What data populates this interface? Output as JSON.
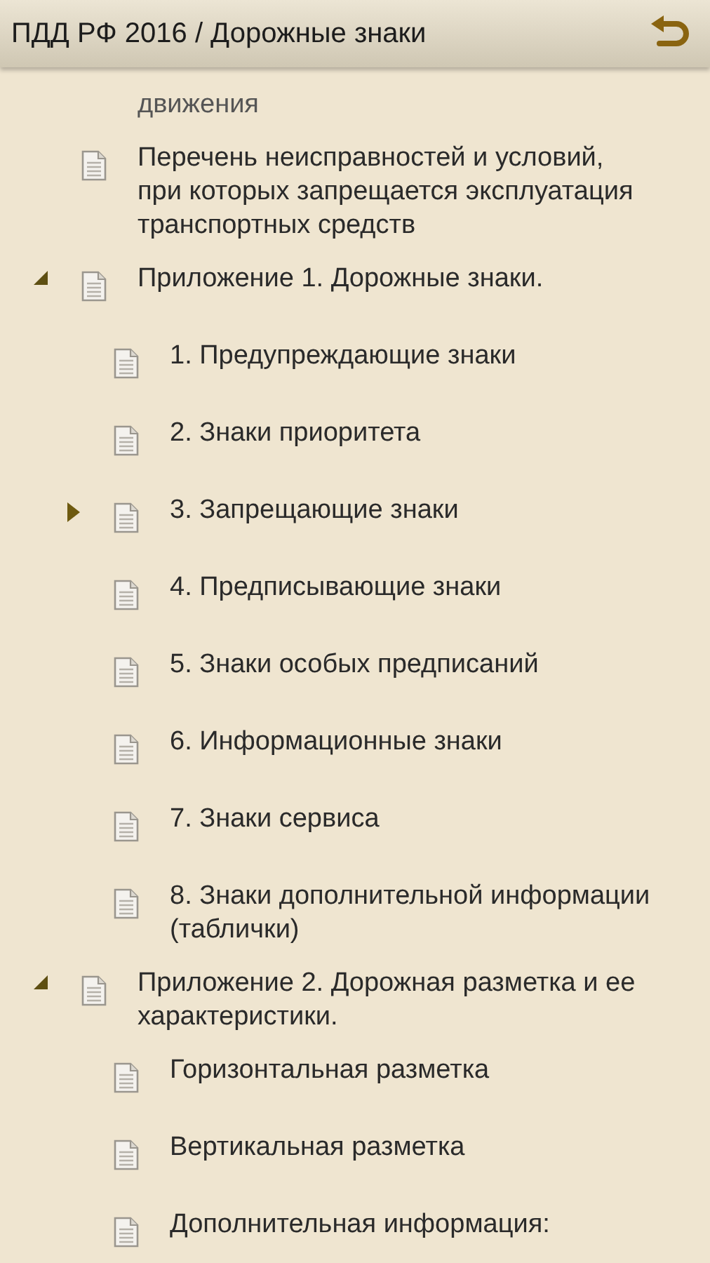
{
  "header": {
    "title": "ПДД РФ 2016 / Дорожные знаки"
  },
  "tree": [
    {
      "kind": "continuation",
      "text": "движения"
    },
    {
      "kind": "page",
      "text": "Перечень неисправностей и условий, при которых запрещается эксплуатация транспортных средств"
    },
    {
      "kind": "folder",
      "expanded": true,
      "text": "Приложение 1. Дорожные знаки.",
      "children": [
        {
          "kind": "page",
          "text": "1. Предупреждающие знаки"
        },
        {
          "kind": "page",
          "text": "2. Знаки приоритета"
        },
        {
          "kind": "folder",
          "expanded": false,
          "text": "3. Запрещающие знаки"
        },
        {
          "kind": "page",
          "text": "4. Предписывающие знаки"
        },
        {
          "kind": "page",
          "text": "5. Знаки особых предписаний"
        },
        {
          "kind": "page",
          "text": "6. Информационные знаки"
        },
        {
          "kind": "page",
          "text": "7. Знаки сервиса"
        },
        {
          "kind": "page",
          "text": "8. Знаки дополнительной информации (таблички)"
        }
      ]
    },
    {
      "kind": "folder",
      "expanded": true,
      "text": "Приложение 2. Дорожная разметка и ее характеристики.",
      "children": [
        {
          "kind": "page",
          "text": "Горизонтальная разметка"
        },
        {
          "kind": "page",
          "text": "Вертикальная разметка"
        },
        {
          "kind": "page",
          "text": "Дополнительная информация:"
        }
      ]
    }
  ]
}
